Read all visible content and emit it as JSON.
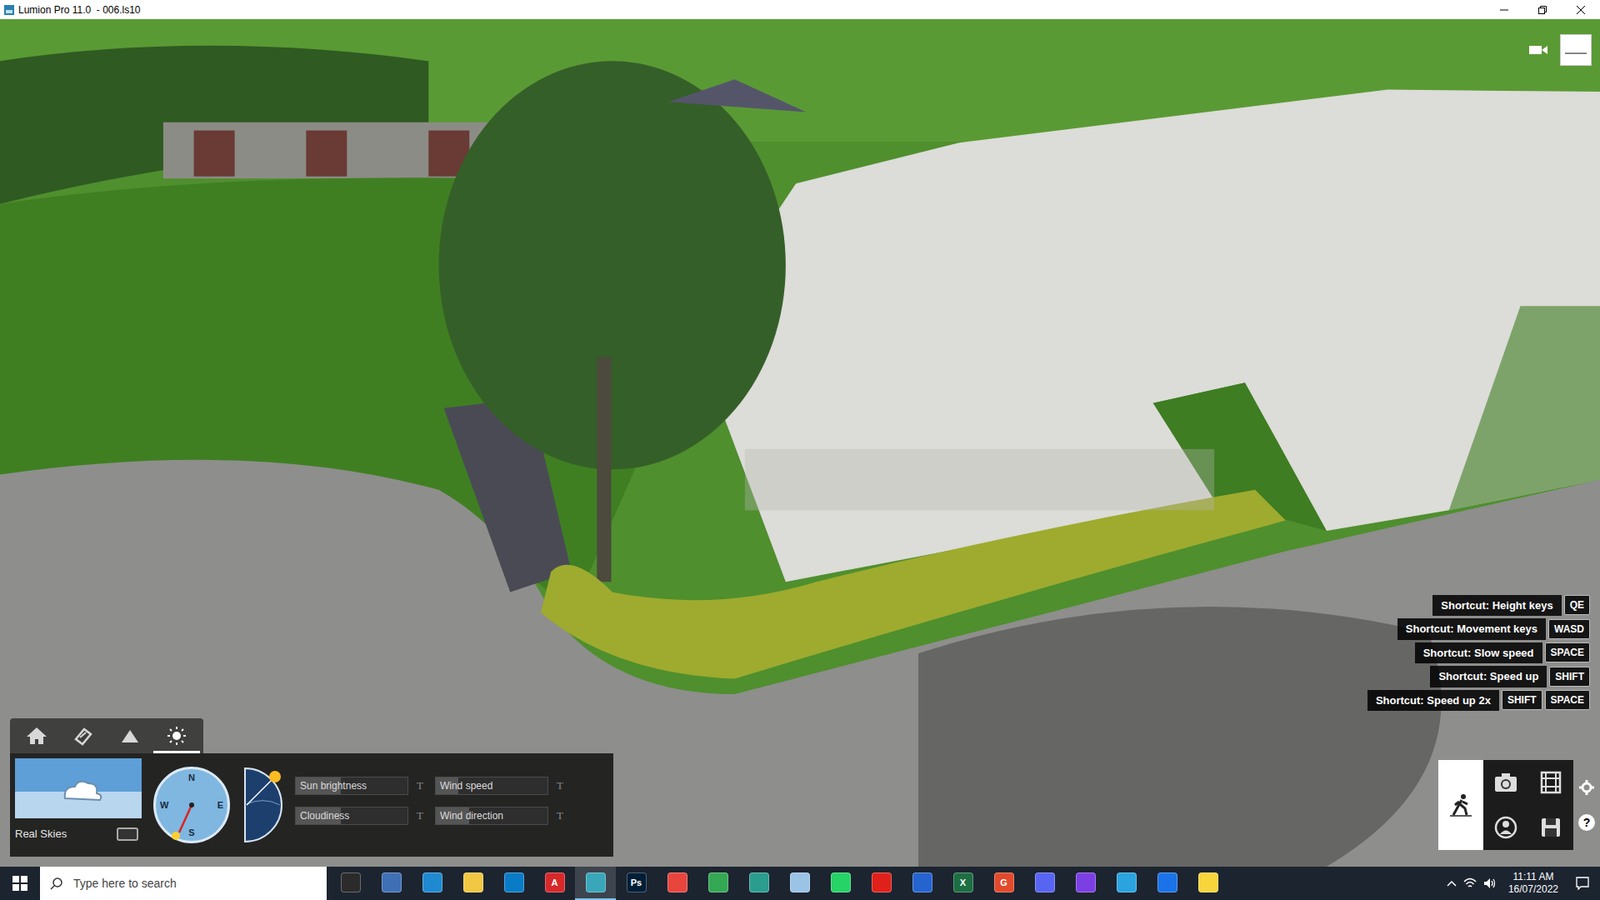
{
  "window": {
    "title": "Lumion Pro 11.0  - 006.ls10"
  },
  "shortcuts": [
    {
      "label": "Shortcut: Height keys",
      "keys": [
        "QE"
      ]
    },
    {
      "label": "Shortcut: Movement keys",
      "keys": [
        "WASD"
      ]
    },
    {
      "label": "Shortcut: Slow speed",
      "keys": [
        "SPACE"
      ]
    },
    {
      "label": "Shortcut: Speed up",
      "keys": [
        "SHIFT"
      ]
    },
    {
      "label": "Shortcut: Speed up 2x",
      "keys": [
        "SHIFT",
        "SPACE"
      ]
    }
  ],
  "weather": {
    "tabs": [
      {
        "kind": "home",
        "selected": false
      },
      {
        "kind": "brush",
        "selected": false
      },
      {
        "kind": "terrain",
        "selected": false
      },
      {
        "kind": "sun",
        "selected": true
      }
    ],
    "real_skies": {
      "label": "Real Skies",
      "checked": false
    },
    "compass": {
      "labels": [
        "N",
        "E",
        "S",
        "W"
      ]
    },
    "sliders": [
      {
        "label": "Sun brightness",
        "level": 0.4,
        "key": "T"
      },
      {
        "label": "Cloudiness",
        "level": 0.4,
        "key": "T"
      },
      {
        "label": "Wind speed",
        "level": 0.2,
        "key": "T"
      },
      {
        "label": "Wind direction",
        "level": 0.3,
        "key": "T"
      }
    ]
  },
  "mode_buttons": [
    {
      "kind": "walk",
      "selected": true
    },
    {
      "kind": "photo",
      "selected": false
    },
    {
      "kind": "movie",
      "selected": false
    },
    {
      "kind": "panorama",
      "selected": false
    },
    {
      "kind": "save",
      "selected": false
    }
  ],
  "help": {
    "label": "?"
  },
  "taskbar": {
    "search": {
      "placeholder": "Type here to search"
    },
    "apps": [
      {
        "glyph": "",
        "color": "#2b2b2b",
        "active": false
      },
      {
        "glyph": "",
        "color": "#3f6fb5",
        "active": false
      },
      {
        "glyph": "",
        "color": "#1f8ad1",
        "active": false
      },
      {
        "glyph": "",
        "color": "#f2c744",
        "active": false
      },
      {
        "glyph": "",
        "color": "#0a7cc7",
        "active": false
      },
      {
        "glyph": "A",
        "color": "#d7282a",
        "active": false
      },
      {
        "glyph": "",
        "color": "#3aa6b9",
        "active": true
      },
      {
        "glyph": "Ps",
        "color": "#001e36",
        "active": false
      },
      {
        "glyph": "",
        "color": "#e8453c",
        "active": false
      },
      {
        "glyph": "",
        "color": "#34a853",
        "active": false
      },
      {
        "glyph": "",
        "color": "#2a9d8f",
        "active": false
      },
      {
        "glyph": "",
        "color": "#9ac3e6",
        "active": false
      },
      {
        "glyph": "",
        "color": "#25d366",
        "active": false
      },
      {
        "glyph": "",
        "color": "#e0201b",
        "active": false
      },
      {
        "glyph": "",
        "color": "#2564cf",
        "active": false
      },
      {
        "glyph": "X",
        "color": "#1d6f42",
        "active": false
      },
      {
        "glyph": "G",
        "color": "#e24a2b",
        "active": false
      },
      {
        "glyph": "",
        "color": "#5865f2",
        "active": false
      },
      {
        "glyph": "",
        "color": "#7b3fe4",
        "active": false
      },
      {
        "glyph": "",
        "color": "#2aa3df",
        "active": false
      },
      {
        "glyph": "",
        "color": "#1a73e8",
        "active": false
      },
      {
        "glyph": "",
        "color": "#f8d53b",
        "active": false
      }
    ],
    "time": "11:11 AM",
    "date": "16/07/2022"
  }
}
